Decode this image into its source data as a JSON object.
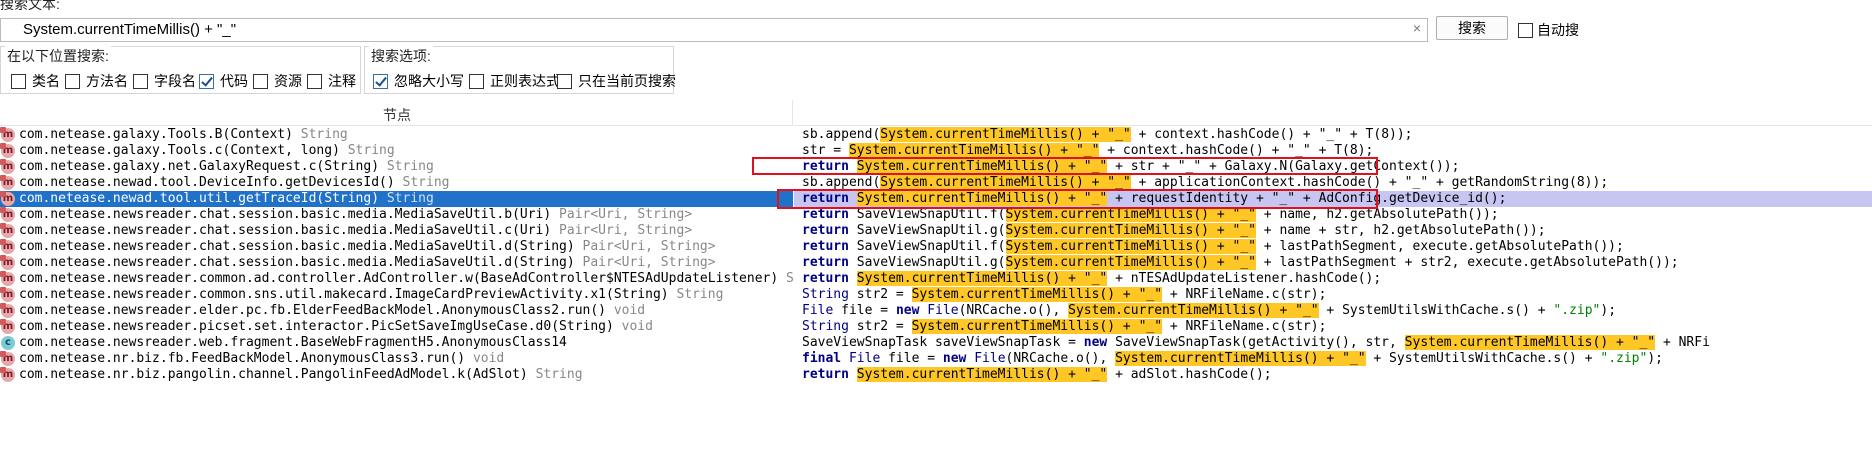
{
  "search": {
    "label": "搜索文本:",
    "value": "System.currentTimeMillis() + \"_\"",
    "clear_icon": "×",
    "button": "搜索",
    "auto_label": "自动搜"
  },
  "location": {
    "title": "在以下位置搜索:",
    "options": [
      {
        "label": "类名",
        "checked": false
      },
      {
        "label": "方法名",
        "checked": false
      },
      {
        "label": "字段名",
        "checked": false
      },
      {
        "label": "代码",
        "checked": true
      },
      {
        "label": "资源",
        "checked": false
      },
      {
        "label": "注释",
        "checked": false
      }
    ]
  },
  "search_options": {
    "title": "搜索选项:",
    "options": [
      {
        "label": "忽略大小写",
        "checked": true
      },
      {
        "label": "正则表达式",
        "checked": false
      },
      {
        "label": "只在当前页搜索",
        "checked": false
      }
    ]
  },
  "table": {
    "header_node": "节点",
    "header_code": "",
    "rows": [
      {
        "icon": "method",
        "name": "com.netease.galaxy.Tools.B(Context)",
        "ret": "String"
      },
      {
        "icon": "method",
        "name": "com.netease.galaxy.Tools.c(Context, long)",
        "ret": "String"
      },
      {
        "icon": "method",
        "name": "com.netease.galaxy.net.GalaxyRequest.c(String)",
        "ret": "String"
      },
      {
        "icon": "method",
        "name": "com.netease.newad.tool.DeviceInfo.getDevicesId()",
        "ret": "String"
      },
      {
        "icon": "method",
        "name": "com.netease.newad.tool.util.getTraceId(String)",
        "ret": "String",
        "selected": true
      },
      {
        "icon": "method",
        "name": "com.netease.newsreader.chat.session.basic.media.MediaSaveUtil.b(Uri)",
        "ret": "Pair<Uri, String>"
      },
      {
        "icon": "method",
        "name": "com.netease.newsreader.chat.session.basic.media.MediaSaveUtil.c(Uri)",
        "ret": "Pair<Uri, String>"
      },
      {
        "icon": "method",
        "name": "com.netease.newsreader.chat.session.basic.media.MediaSaveUtil.d(String)",
        "ret": "Pair<Uri, String>"
      },
      {
        "icon": "method",
        "name": "com.netease.newsreader.chat.session.basic.media.MediaSaveUtil.d(String)",
        "ret": "Pair<Uri, String>"
      },
      {
        "icon": "method",
        "name": "com.netease.newsreader.common.ad.controller.AdController.w(BaseAdController$NTESAdUpdateListener)",
        "ret": "String"
      },
      {
        "icon": "method",
        "name": "com.netease.newsreader.common.sns.util.makecard.ImageCardPreviewActivity.x1(String)",
        "ret": "String"
      },
      {
        "icon": "method",
        "name": "com.netease.newsreader.elder.pc.fb.ElderFeedBackModel.AnonymousClass2.run()",
        "ret": "void"
      },
      {
        "icon": "method",
        "name": "com.netease.newsreader.picset.set.interactor.PicSetSaveImgUseCase.d0(String)",
        "ret": "void"
      },
      {
        "icon": "class",
        "name": "com.netease.newsreader.web.fragment.BaseWebFragmentH5.AnonymousClass14",
        "ret": ""
      },
      {
        "icon": "method",
        "name": "com.netease.nr.biz.fb.FeedBackModel.AnonymousClass3.run()",
        "ret": "void"
      },
      {
        "icon": "method",
        "name": "com.netease.nr.biz.pangolin.channel.PangolinFeedAdModel.k(AdSlot)",
        "ret": "String"
      }
    ],
    "code": [
      [
        {
          "t": "sb.append("
        },
        {
          "t": "System.currentTimeMillis() + \"_\"",
          "c": "hl"
        },
        {
          "t": " + context.hashCode() + \"_\" + T(8));"
        }
      ],
      [
        {
          "t": "str = "
        },
        {
          "t": "System.currentTimeMillis() + \"_\"",
          "c": "hl"
        },
        {
          "t": " + context.hashCode() + \"_\" + T(8);"
        }
      ],
      [
        {
          "t": "return ",
          "c": "kw"
        },
        {
          "t": "System.currentTimeMillis() + \"_\"",
          "c": "hl"
        },
        {
          "t": " + str + \"_\" + Galaxy.N(Galaxy.getContext());"
        }
      ],
      [
        {
          "t": "sb.append("
        },
        {
          "t": "System.currentTimeMillis() + \"_\"",
          "c": "hl"
        },
        {
          "t": " + applicationContext.hashCode() + \"_\" + getRandomString(8));"
        }
      ],
      [
        {
          "t": "return ",
          "c": "kw"
        },
        {
          "t": "System.currentTimeMillis() + \"_\"",
          "c": "hl"
        },
        {
          "t": " + requestIdentity + \"_\" + AdConfig.getDevice_id();"
        }
      ],
      [
        {
          "t": "return ",
          "c": "kw"
        },
        {
          "t": "SaveViewSnapUtil.f("
        },
        {
          "t": "System.currentTimeMillis() + \"_\"",
          "c": "hl"
        },
        {
          "t": " + name, h2.getAbsolutePath());"
        }
      ],
      [
        {
          "t": "return ",
          "c": "kw"
        },
        {
          "t": "SaveViewSnapUtil.g("
        },
        {
          "t": "System.currentTimeMillis() + \"_\"",
          "c": "hl"
        },
        {
          "t": " + name + str, h2.getAbsolutePath());"
        }
      ],
      [
        {
          "t": "return ",
          "c": "kw"
        },
        {
          "t": "SaveViewSnapUtil.f("
        },
        {
          "t": "System.currentTimeMillis() + \"_\"",
          "c": "hl"
        },
        {
          "t": " + lastPathSegment, execute.getAbsolutePath());"
        }
      ],
      [
        {
          "t": "return ",
          "c": "kw"
        },
        {
          "t": "SaveViewSnapUtil.g("
        },
        {
          "t": "System.currentTimeMillis() + \"_\"",
          "c": "hl"
        },
        {
          "t": " + lastPathSegment + str2, execute.getAbsolutePath());"
        }
      ],
      [
        {
          "t": "return ",
          "c": "kw"
        },
        {
          "t": "System.currentTimeMillis() + \"_\"",
          "c": "hl"
        },
        {
          "t": " + nTESAdUpdateListener.hashCode();"
        }
      ],
      [
        {
          "t": "String ",
          "c": "ty"
        },
        {
          "t": "str2 = "
        },
        {
          "t": "System.currentTimeMillis() + \"_\"",
          "c": "hl"
        },
        {
          "t": " + NRFileName.c(str);"
        }
      ],
      [
        {
          "t": "File ",
          "c": "ty"
        },
        {
          "t": "file = "
        },
        {
          "t": "new ",
          "c": "kw"
        },
        {
          "t": "File",
          "c": "ty"
        },
        {
          "t": "(NRCache.o(), "
        },
        {
          "t": "System.currentTimeMillis() + \"_\"",
          "c": "hl"
        },
        {
          "t": " + SystemUtilsWithCache.s() + "
        },
        {
          "t": "\".zip\"",
          "c": "str"
        },
        {
          "t": ");"
        }
      ],
      [
        {
          "t": "String ",
          "c": "ty"
        },
        {
          "t": "str2 = "
        },
        {
          "t": "System.currentTimeMillis() + \"_\"",
          "c": "hl"
        },
        {
          "t": " + NRFileName.c(str);"
        }
      ],
      [
        {
          "t": "SaveViewSnapTask saveViewSnapTask = "
        },
        {
          "t": "new ",
          "c": "kw"
        },
        {
          "t": "SaveViewSnapTask(getActivity(), str, "
        },
        {
          "t": "System.currentTimeMillis() + \"_\"",
          "c": "hl"
        },
        {
          "t": " + NRFi"
        }
      ],
      [
        {
          "t": "final ",
          "c": "kw"
        },
        {
          "t": "File ",
          "c": "ty"
        },
        {
          "t": "file = "
        },
        {
          "t": "new ",
          "c": "kw"
        },
        {
          "t": "File",
          "c": "ty"
        },
        {
          "t": "(NRCache.o(), "
        },
        {
          "t": "System.currentTimeMillis() + \"_\"",
          "c": "hl"
        },
        {
          "t": " + SystemUtilsWithCache.s() + "
        },
        {
          "t": "\".zip\"",
          "c": "str"
        },
        {
          "t": ");"
        }
      ],
      [
        {
          "t": "return ",
          "c": "kw"
        },
        {
          "t": "System.currentTimeMillis() + \"_\"",
          "c": "hl"
        },
        {
          "t": " + adSlot.hashCode();"
        }
      ]
    ]
  },
  "colors": {
    "selection": "#1f72c8",
    "code_selection": "#c7c5f2",
    "highlight": "#ffc726",
    "annotation_box": "#e0101e"
  }
}
